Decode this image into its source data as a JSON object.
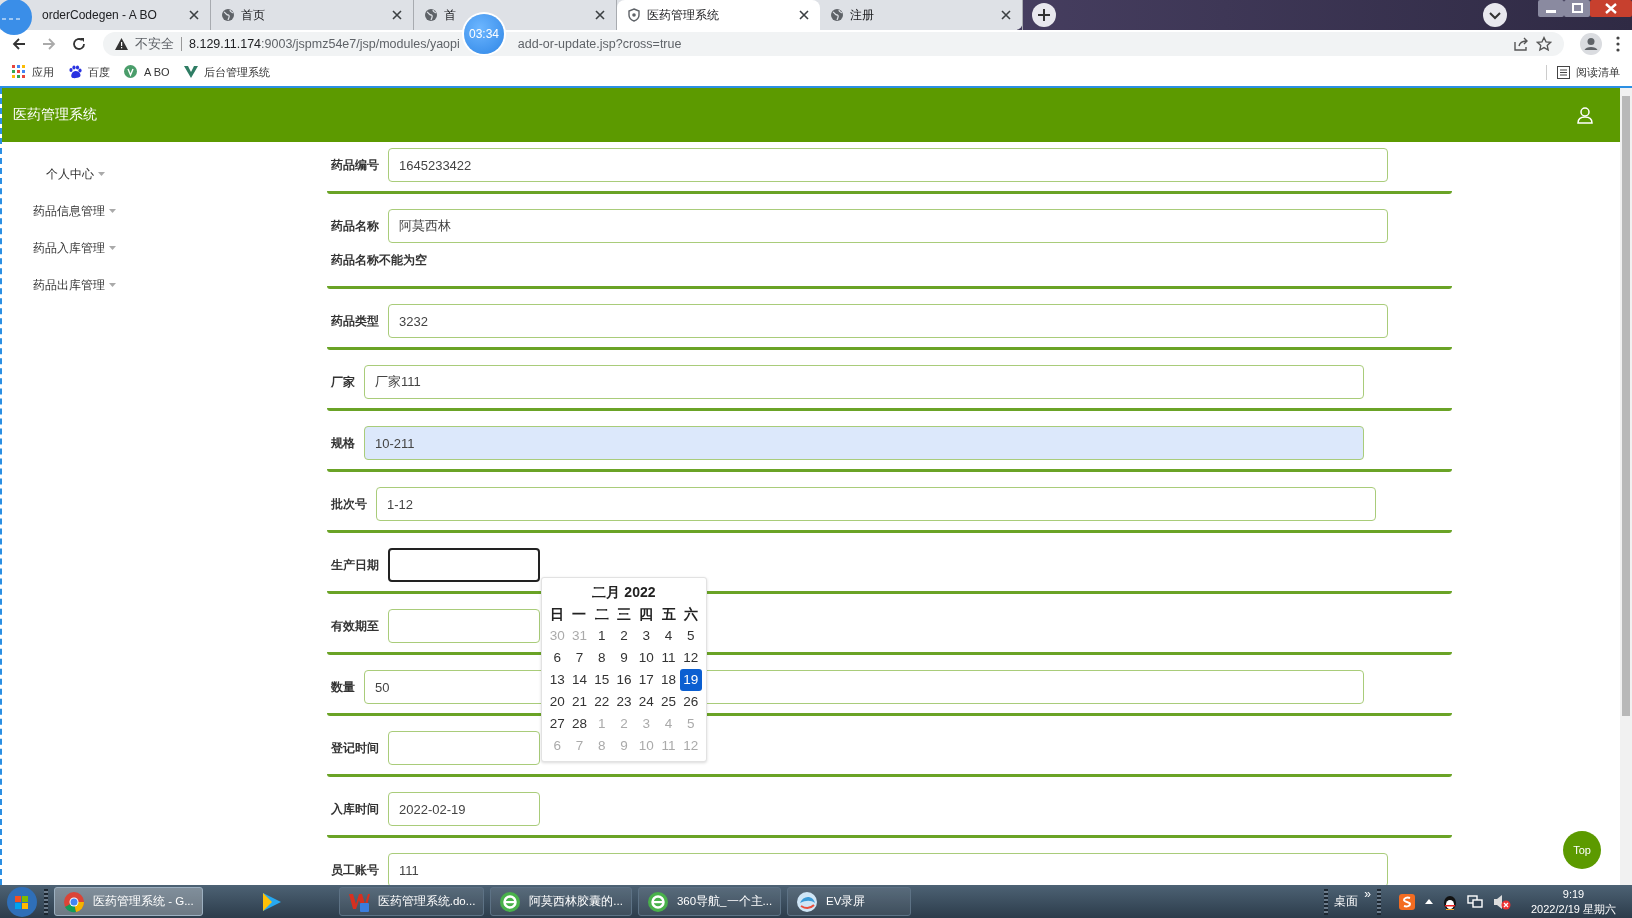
{
  "browser": {
    "tabs": [
      {
        "title": "orderCodegen - A BO",
        "kind": "plain",
        "selected": false
      },
      {
        "title": "首页",
        "kind": "web",
        "selected": false
      },
      {
        "title": "首",
        "kind": "web",
        "selected": false
      },
      {
        "title": "医药管理系统",
        "kind": "secure",
        "selected": true
      },
      {
        "title": "注册",
        "kind": "web",
        "selected": false
      }
    ],
    "address": {
      "warning": "不安全",
      "host": "8.129.11.174",
      "path_start": ":9003/jspmz54e7/jsp/modules/yaopi",
      "path_end": "add-or-update.jsp?cross=true"
    },
    "bookmarks": [
      {
        "label": "应用",
        "kind": "apps"
      },
      {
        "label": "百度",
        "kind": "site"
      },
      {
        "label": "A BO",
        "kind": "badge"
      },
      {
        "label": "后台管理系统",
        "kind": "mark"
      }
    ],
    "reading_list": "阅读清单"
  },
  "recorder": {
    "timer": "03:34"
  },
  "app": {
    "title": "医药管理系统",
    "menu": [
      {
        "label": "个人中心"
      },
      {
        "label": "药品信息管理"
      },
      {
        "label": "药品入库管理"
      },
      {
        "label": "药品出库管理"
      }
    ],
    "fields": [
      {
        "label": "药品编号",
        "kind": "text",
        "value": "1645233422",
        "focused": false,
        "autofilled": false
      },
      {
        "label": "药品名称",
        "kind": "text",
        "value": "阿莫西林",
        "focused": false,
        "autofilled": false,
        "error": "药品名称不能为空"
      },
      {
        "label": "药品类型",
        "kind": "text",
        "value": "3232",
        "focused": false,
        "autofilled": false
      },
      {
        "label": "厂家",
        "kind": "text",
        "value": "厂家111",
        "focused": false,
        "autofilled": false
      },
      {
        "label": "规格",
        "kind": "text",
        "value": "10-211",
        "focused": false,
        "autofilled": true
      },
      {
        "label": "批次号",
        "kind": "text",
        "value": "1-12",
        "focused": false,
        "autofilled": false
      },
      {
        "label": "生产日期",
        "kind": "date",
        "focused": true,
        "autofilled": false
      },
      {
        "label": "有效期至",
        "kind": "date",
        "focused": false,
        "autofilled": false
      },
      {
        "label": "数量",
        "kind": "text",
        "value": "50",
        "focused": false,
        "autofilled": false
      },
      {
        "label": "登记时间",
        "kind": "date",
        "focused": false,
        "autofilled": false
      },
      {
        "label": "入库时间",
        "kind": "date",
        "value": "2022-02-19",
        "focused": false,
        "autofilled": false
      },
      {
        "label": "员工账号",
        "kind": "text",
        "value": "111",
        "focused": false,
        "autofilled": false
      }
    ]
  },
  "date_picker": {
    "title": "二月 2022",
    "weekdays": [
      "日",
      "一",
      "二",
      "三",
      "四",
      "五",
      "六"
    ],
    "weeks": [
      [
        {
          "day": "30",
          "other_month": true,
          "selected": false
        },
        {
          "day": "31",
          "other_month": true,
          "selected": false
        },
        {
          "day": "1",
          "other_month": false,
          "selected": false
        },
        {
          "day": "2",
          "other_month": false,
          "selected": false
        },
        {
          "day": "3",
          "other_month": false,
          "selected": false
        },
        {
          "day": "4",
          "other_month": false,
          "selected": false
        },
        {
          "day": "5",
          "other_month": false,
          "selected": false
        }
      ],
      [
        {
          "day": "6",
          "other_month": false,
          "selected": false
        },
        {
          "day": "7",
          "other_month": false,
          "selected": false
        },
        {
          "day": "8",
          "other_month": false,
          "selected": false
        },
        {
          "day": "9",
          "other_month": false,
          "selected": false
        },
        {
          "day": "10",
          "other_month": false,
          "selected": false
        },
        {
          "day": "11",
          "other_month": false,
          "selected": false
        },
        {
          "day": "12",
          "other_month": false,
          "selected": false
        }
      ],
      [
        {
          "day": "13",
          "other_month": false,
          "selected": false
        },
        {
          "day": "14",
          "other_month": false,
          "selected": false
        },
        {
          "day": "15",
          "other_month": false,
          "selected": false
        },
        {
          "day": "16",
          "other_month": false,
          "selected": false
        },
        {
          "day": "17",
          "other_month": false,
          "selected": false
        },
        {
          "day": "18",
          "other_month": false,
          "selected": false
        },
        {
          "day": "19",
          "other_month": false,
          "selected": true
        }
      ],
      [
        {
          "day": "20",
          "other_month": false,
          "selected": false
        },
        {
          "day": "21",
          "other_month": false,
          "selected": false
        },
        {
          "day": "22",
          "other_month": false,
          "selected": false
        },
        {
          "day": "23",
          "other_month": false,
          "selected": false
        },
        {
          "day": "24",
          "other_month": false,
          "selected": false
        },
        {
          "day": "25",
          "other_month": false,
          "selected": false
        },
        {
          "day": "26",
          "other_month": false,
          "selected": false
        }
      ],
      [
        {
          "day": "27",
          "other_month": false,
          "selected": false
        },
        {
          "day": "28",
          "other_month": false,
          "selected": false
        },
        {
          "day": "1",
          "other_month": true,
          "selected": false
        },
        {
          "day": "2",
          "other_month": true,
          "selected": false
        },
        {
          "day": "3",
          "other_month": true,
          "selected": false
        },
        {
          "day": "4",
          "other_month": true,
          "selected": false
        },
        {
          "day": "5",
          "other_month": true,
          "selected": false
        }
      ],
      [
        {
          "day": "6",
          "other_month": true,
          "selected": false
        },
        {
          "day": "7",
          "other_month": true,
          "selected": false
        },
        {
          "day": "8",
          "other_month": true,
          "selected": false
        },
        {
          "day": "9",
          "other_month": true,
          "selected": false
        },
        {
          "day": "10",
          "other_month": true,
          "selected": false
        },
        {
          "day": "11",
          "other_month": true,
          "selected": false
        },
        {
          "day": "12",
          "other_month": true,
          "selected": false
        }
      ]
    ]
  },
  "top_button": "Top",
  "taskbar": {
    "items": [
      {
        "label": "医药管理系统 - G...",
        "kind": "browser",
        "active": true
      },
      {
        "kind": "player",
        "active": false
      },
      {
        "label": "医药管理系统.do...",
        "kind": "document",
        "active": false
      },
      {
        "label": "阿莫西林胶囊的...",
        "kind": "web",
        "active": false
      },
      {
        "label": "360导航_一个主...",
        "kind": "web",
        "active": false
      },
      {
        "label": "EV录屏",
        "kind": "recorder",
        "active": false
      }
    ],
    "desktop": "桌面",
    "more": "»",
    "time": "9:19",
    "date": "2022/2/19 星期六"
  }
}
